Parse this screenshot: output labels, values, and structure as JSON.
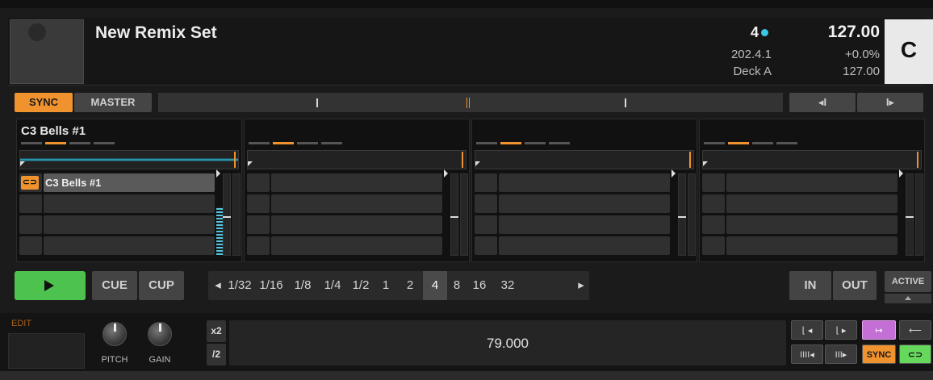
{
  "header": {
    "title": "New Remix Set",
    "beats": "4",
    "position": "202.4.1",
    "deck": "Deck A",
    "bpm": "127.00",
    "pitch_offset": "+0.0%",
    "tempo": "127.00",
    "deck_letter": "C"
  },
  "transport": {
    "sync_label": "SYNC",
    "master_label": "MASTER",
    "nudge_left": "◂I",
    "nudge_right": "I▸"
  },
  "slots": [
    {
      "title": "C3 Bells #1",
      "cell_label": "C3 Bells #1",
      "has_loop_icon": true
    },
    {
      "title": "",
      "cell_label": "",
      "has_loop_icon": false
    },
    {
      "title": "",
      "cell_label": "",
      "has_loop_icon": false
    },
    {
      "title": "",
      "cell_label": "",
      "has_loop_icon": false
    }
  ],
  "controls": {
    "play_icon": "play-icon",
    "cue_label": "CUE",
    "cup_label": "CUP",
    "beatjump_prev": "◂",
    "beatjump_next": "▸",
    "beatjump_sizes": [
      "1/32",
      "1/16",
      "1/8",
      "1/4",
      "1/2",
      "1",
      "2",
      "4",
      "8",
      "16",
      "32"
    ],
    "beatjump_selected": "4",
    "in_label": "IN",
    "out_label": "OUT",
    "active_label": "ACTIVE"
  },
  "bottom": {
    "edit_label": "EDIT",
    "pitch_label": "PITCH",
    "gain_label": "GAIN",
    "x2_label": "x2",
    "div2_label": "/2",
    "loop_value": "79.000",
    "sync_small_label": "SYNC"
  },
  "colors": {
    "accent_orange": "#f0922e",
    "play_green": "#4ec24e",
    "beat_dot_cyan": "#3cc6e8",
    "magenta": "#d27ae0",
    "loop_green": "#66d85c"
  }
}
